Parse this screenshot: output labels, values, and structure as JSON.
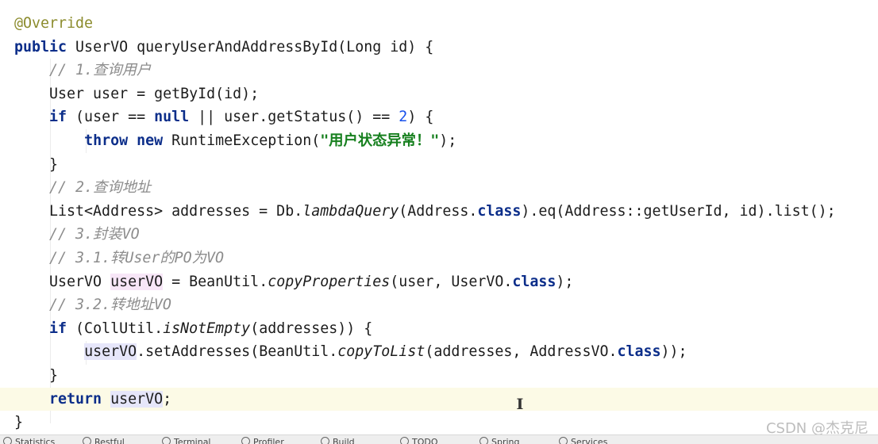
{
  "editor": {
    "lines": [
      {
        "tokens": [
          {
            "t": "@Override",
            "c": "ann"
          }
        ]
      },
      {
        "tokens": [
          {
            "t": "public",
            "c": "kw"
          },
          {
            "t": " UserVO queryUserAndAddressById(Long id) {"
          }
        ]
      },
      {
        "tokens": [
          {
            "t": "    "
          },
          {
            "t": "// 1.查询用户",
            "c": "cm"
          }
        ]
      },
      {
        "tokens": [
          {
            "t": "    User user = getById(id);"
          }
        ]
      },
      {
        "tokens": [
          {
            "t": "    "
          },
          {
            "t": "if",
            "c": "kw"
          },
          {
            "t": " (user == "
          },
          {
            "t": "null",
            "c": "kw"
          },
          {
            "t": " || user.getStatus() == "
          },
          {
            "t": "2",
            "c": "num"
          },
          {
            "t": ") {"
          }
        ]
      },
      {
        "tokens": [
          {
            "t": "        "
          },
          {
            "t": "throw",
            "c": "kw"
          },
          {
            "t": " "
          },
          {
            "t": "new",
            "c": "kw"
          },
          {
            "t": " RuntimeException("
          },
          {
            "t": "\"用户状态异常！\"",
            "c": "str"
          },
          {
            "t": ");"
          }
        ]
      },
      {
        "tokens": [
          {
            "t": "    }"
          }
        ]
      },
      {
        "tokens": [
          {
            "t": "    "
          },
          {
            "t": "// 2.查询地址",
            "c": "cm"
          }
        ]
      },
      {
        "tokens": [
          {
            "t": "    List<Address> addresses = Db."
          },
          {
            "t": "lambdaQuery",
            "c": "it"
          },
          {
            "t": "(Address."
          },
          {
            "t": "class",
            "c": "kw"
          },
          {
            "t": ").eq(Address::getUserId, id).list();"
          }
        ]
      },
      {
        "tokens": [
          {
            "t": "    "
          },
          {
            "t": "// 3.封装VO",
            "c": "cm"
          }
        ]
      },
      {
        "tokens": [
          {
            "t": "    "
          },
          {
            "t": "// 3.1.转User的PO为VO",
            "c": "cm"
          }
        ]
      },
      {
        "tokens": [
          {
            "t": "    UserVO "
          },
          {
            "t": "userVO",
            "c": "hl"
          },
          {
            "t": " = BeanUtil."
          },
          {
            "t": "copyProperties",
            "c": "it"
          },
          {
            "t": "(user, UserVO."
          },
          {
            "t": "class",
            "c": "kw"
          },
          {
            "t": ");"
          }
        ]
      },
      {
        "tokens": [
          {
            "t": "    "
          },
          {
            "t": "// 3.2.转地址VO",
            "c": "cm"
          }
        ]
      },
      {
        "tokens": [
          {
            "t": "    "
          },
          {
            "t": "if",
            "c": "kw"
          },
          {
            "t": " (CollUtil."
          },
          {
            "t": "isNotEmpty",
            "c": "it"
          },
          {
            "t": "(addresses)) {"
          }
        ]
      },
      {
        "tokens": [
          {
            "t": "        "
          },
          {
            "t": "userVO",
            "c": "hl2"
          },
          {
            "t": ".setAddresses(BeanUtil."
          },
          {
            "t": "copyToList",
            "c": "it"
          },
          {
            "t": "(addresses, AddressVO."
          },
          {
            "t": "class",
            "c": "kw"
          },
          {
            "t": "));"
          }
        ]
      },
      {
        "tokens": [
          {
            "t": "    }"
          }
        ]
      },
      {
        "tokens": [
          {
            "t": "    "
          },
          {
            "t": "return",
            "c": "kw"
          },
          {
            "t": " "
          },
          {
            "t": "userVO",
            "c": "hl2"
          },
          {
            "t": ";"
          }
        ],
        "current": true
      },
      {
        "tokens": [
          {
            "t": "}"
          }
        ]
      }
    ],
    "caret_glyph": "I"
  },
  "watermark": "CSDN @杰克尼",
  "statusbar": {
    "items": [
      "Statistics",
      "Restful",
      "Terminal",
      "Profiler",
      "Build",
      "TODO",
      "Spring",
      "Services"
    ]
  }
}
